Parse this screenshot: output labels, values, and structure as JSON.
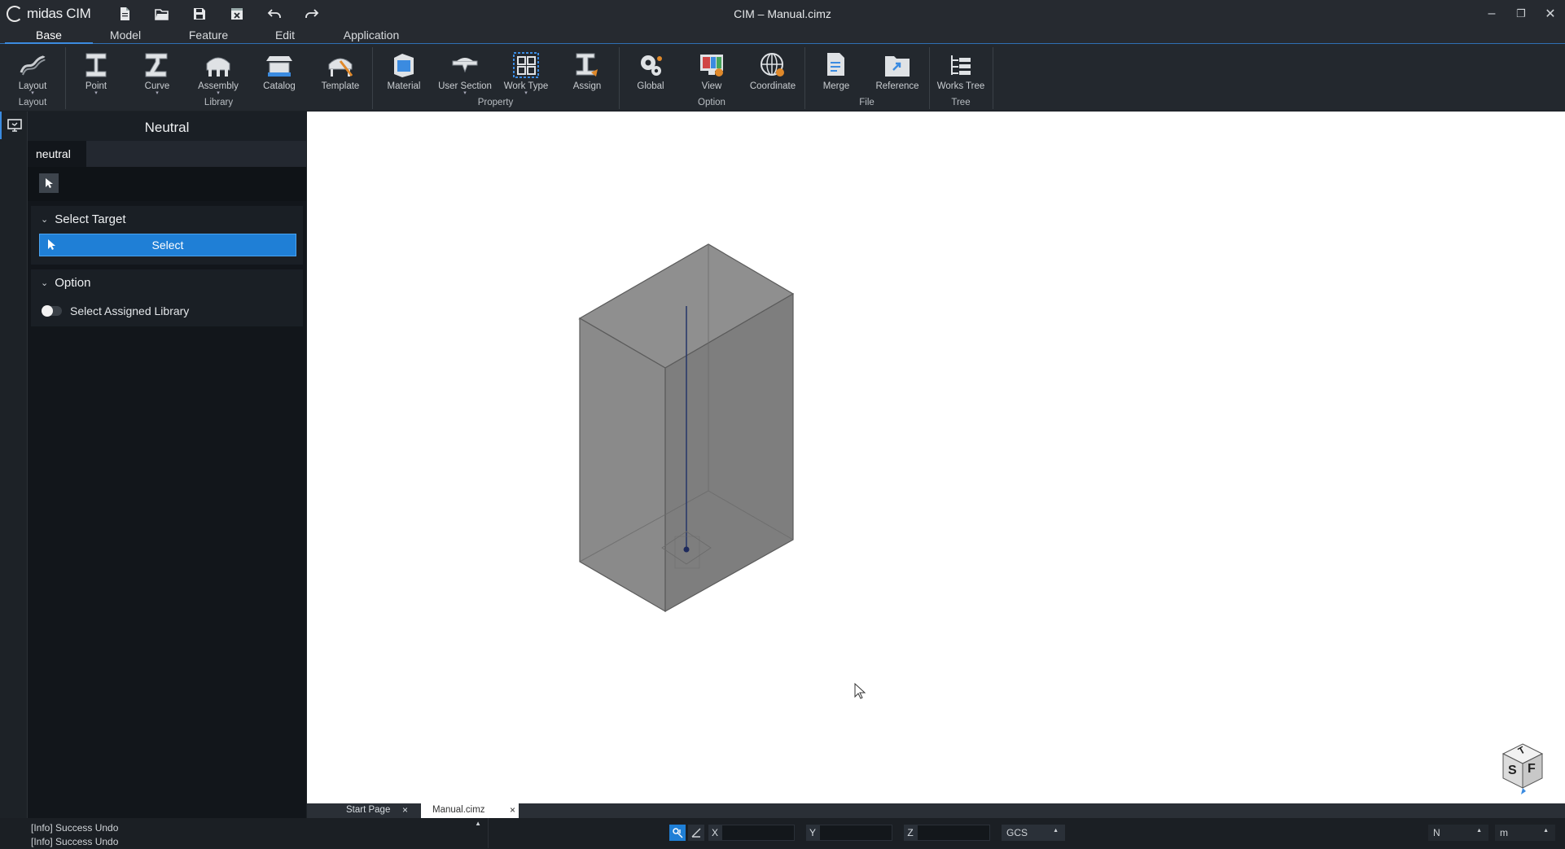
{
  "app": {
    "name": "midas CIM",
    "title": "CIM – Manual.cimz"
  },
  "quick_access": [
    "new-file-icon",
    "open-folder-icon",
    "save-icon",
    "close-file-icon",
    "undo-icon",
    "redo-icon"
  ],
  "window_controls": {
    "minimize": "–",
    "restore": "❐",
    "close": "✕"
  },
  "ribbon_tabs": [
    {
      "label": "Base",
      "active": true
    },
    {
      "label": "Model"
    },
    {
      "label": "Feature"
    },
    {
      "label": "Edit"
    },
    {
      "label": "Application"
    }
  ],
  "ribbon": {
    "buttons": [
      {
        "label": "Layout",
        "dropdown": true,
        "icon": "layout-icon"
      },
      {
        "label": "Point",
        "dropdown": true,
        "icon": "point-icon"
      },
      {
        "label": "Curve",
        "dropdown": true,
        "icon": "curve-icon"
      },
      {
        "label": "Assembly",
        "dropdown": true,
        "icon": "assembly-icon"
      },
      {
        "label": "Catalog",
        "icon": "catalog-icon"
      },
      {
        "label": "Template",
        "icon": "template-icon"
      },
      {
        "label": "Material",
        "icon": "material-icon"
      },
      {
        "label": "User Section",
        "dropdown": true,
        "icon": "user-section-icon"
      },
      {
        "label": "Work Type",
        "dropdown": true,
        "icon": "work-type-icon"
      },
      {
        "label": "Assign",
        "icon": "assign-icon"
      },
      {
        "label": "Global",
        "icon": "global-icon"
      },
      {
        "label": "View",
        "icon": "view-icon"
      },
      {
        "label": "Coordinate",
        "icon": "coordinate-icon"
      },
      {
        "label": "Merge",
        "icon": "merge-icon"
      },
      {
        "label": "Reference",
        "icon": "reference-icon"
      },
      {
        "label": "Works Tree",
        "icon": "works-tree-icon"
      }
    ],
    "groups": [
      "Layout",
      "Library",
      "Property",
      "Option",
      "File",
      "Tree"
    ]
  },
  "panel": {
    "title": "Neutral",
    "tab": "neutral",
    "select_target": {
      "header": "Select Target",
      "button": "Select"
    },
    "option": {
      "header": "Option",
      "toggle_label": "Select Assigned Library",
      "toggle_on": false
    }
  },
  "doc_tabs": [
    {
      "label": "Start Page",
      "active": false
    },
    {
      "label": "Manual.cimz",
      "active": true
    }
  ],
  "status": {
    "log": [
      "[Info] Success Undo",
      "[Info] Success Undo"
    ],
    "coords": {
      "x_label": "X",
      "y_label": "Y",
      "z_label": "Z",
      "x": "",
      "y": "",
      "z": ""
    },
    "coord_system": "GCS",
    "force_unit": "N",
    "length_unit": "m"
  },
  "view_cube": {
    "faces": [
      "T",
      "S",
      "F"
    ]
  },
  "colors": {
    "accent": "#1f7fd6",
    "background": "#1c2126",
    "viewport": "#ffffff",
    "model_fill": "#8a8a8a"
  }
}
